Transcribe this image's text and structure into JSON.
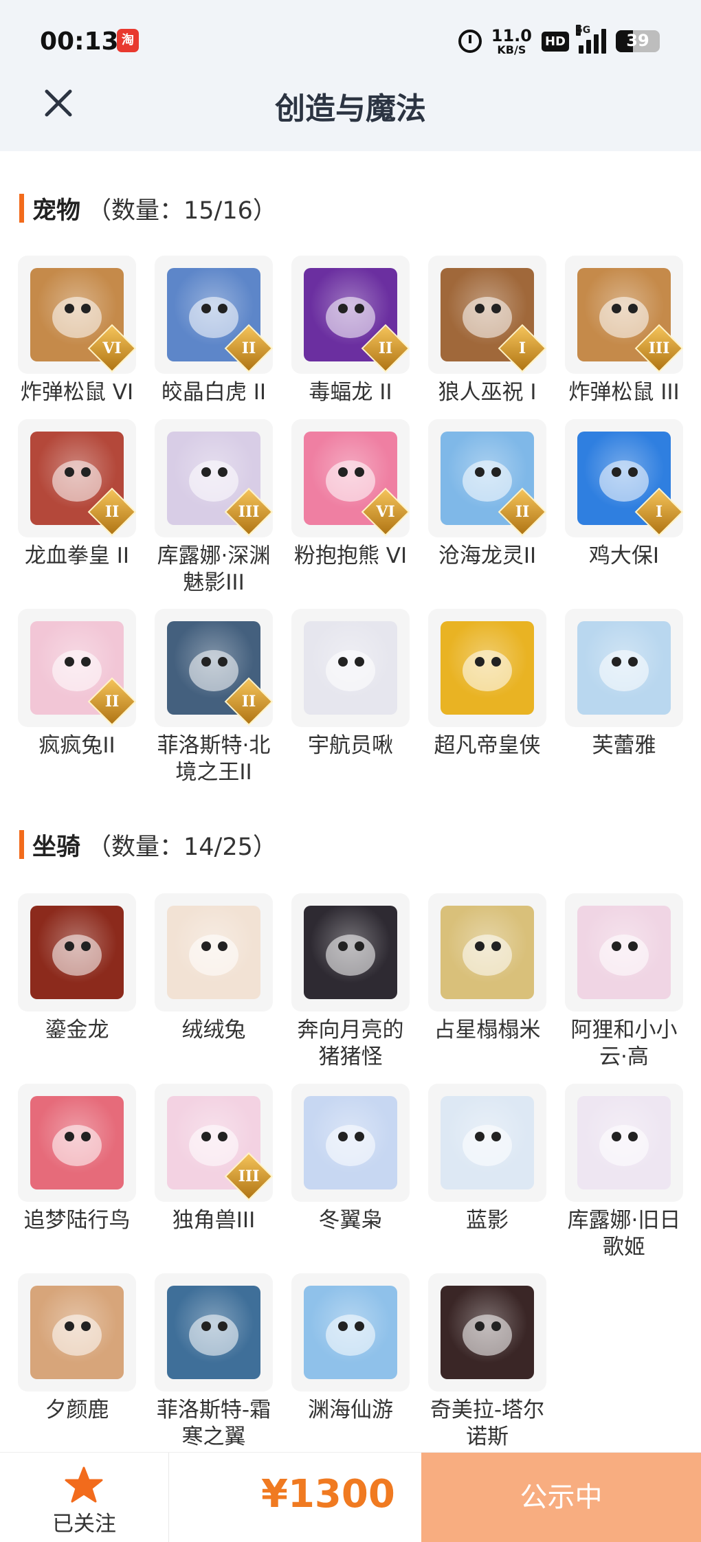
{
  "status_bar": {
    "time": "00:13",
    "app_badge": "淘",
    "network_speed_value": "11.0",
    "network_speed_unit": "KB/S",
    "hd_label": "HD",
    "network_type": "5G",
    "battery_level": "39"
  },
  "nav": {
    "title": "创造与魔法"
  },
  "pets": {
    "name": "宠物",
    "count_label": "（数量：15/16）",
    "items": [
      {
        "name": "炸弹松鼠 VI",
        "tier": "VI",
        "color": "#c58a4a"
      },
      {
        "name": "皎晶白虎 II",
        "tier": "II",
        "color": "#5d86c9"
      },
      {
        "name": "毒蝠龙 II",
        "tier": "II",
        "color": "#6b2fa0"
      },
      {
        "name": "狼人巫祝 I",
        "tier": "I",
        "color": "#a0683a"
      },
      {
        "name": "炸弹松鼠 III",
        "tier": "III",
        "color": "#c58a4a"
      },
      {
        "name": "龙血拳皇 II",
        "tier": "II",
        "color": "#b4483a"
      },
      {
        "name": "库露娜·深渊魅影III",
        "tier": "III",
        "color": "#d8cde6"
      },
      {
        "name": "粉抱抱熊 VI",
        "tier": "VI",
        "color": "#ef7fa2"
      },
      {
        "name": "沧海龙灵II",
        "tier": "II",
        "color": "#7fb8e8"
      },
      {
        "name": "鸡大保I",
        "tier": "I",
        "color": "#2f7fe0"
      },
      {
        "name": "疯疯兔II",
        "tier": "II",
        "color": "#f2c6d6"
      },
      {
        "name": "菲洛斯特·北境之王II",
        "tier": "II",
        "color": "#44607e"
      },
      {
        "name": "宇航员啾",
        "tier": "",
        "color": "#e6e6ee"
      },
      {
        "name": "超凡帝皇侠",
        "tier": "",
        "color": "#e9b323"
      },
      {
        "name": "芙蕾雅",
        "tier": "",
        "color": "#b9d7ef"
      }
    ]
  },
  "mounts": {
    "name": "坐骑",
    "count_label": "（数量：14/25）",
    "items": [
      {
        "name": "鎏金龙",
        "tier": "",
        "color": "#8c2a1c"
      },
      {
        "name": "绒绒兔",
        "tier": "",
        "color": "#f2e2d4"
      },
      {
        "name": "奔向月亮的猪猪怪",
        "tier": "",
        "color": "#2e2a32"
      },
      {
        "name": "占星榻榻米",
        "tier": "",
        "color": "#d9c07a"
      },
      {
        "name": "阿狸和小小云·高",
        "tier": "",
        "color": "#f0d5e4"
      },
      {
        "name": "追梦陆行鸟",
        "tier": "",
        "color": "#e66b7a"
      },
      {
        "name": "独角兽III",
        "tier": "III",
        "color": "#f3d2e2"
      },
      {
        "name": "冬翼枭",
        "tier": "",
        "color": "#c7d7f2"
      },
      {
        "name": "蓝影",
        "tier": "",
        "color": "#dde8f4"
      },
      {
        "name": "库露娜·旧日歌姬",
        "tier": "",
        "color": "#eee6f2"
      },
      {
        "name": "夕颜鹿",
        "tier": "",
        "color": "#d7a57a"
      },
      {
        "name": "菲洛斯特-霜寒之翼",
        "tier": "",
        "color": "#3f6f99"
      },
      {
        "name": "渊海仙游",
        "tier": "",
        "color": "#8fc1ea"
      },
      {
        "name": "奇美拉-塔尔诺斯",
        "tier": "",
        "color": "#3a2626"
      }
    ]
  },
  "bottom": {
    "follow_label": "已关注",
    "price": "¥1300",
    "status_button": "公示中"
  },
  "colors": {
    "accent": "#f26b1c",
    "price": "#f07a21",
    "status_button_bg": "#f8ad80",
    "header_bg": "#f1f4f8"
  }
}
